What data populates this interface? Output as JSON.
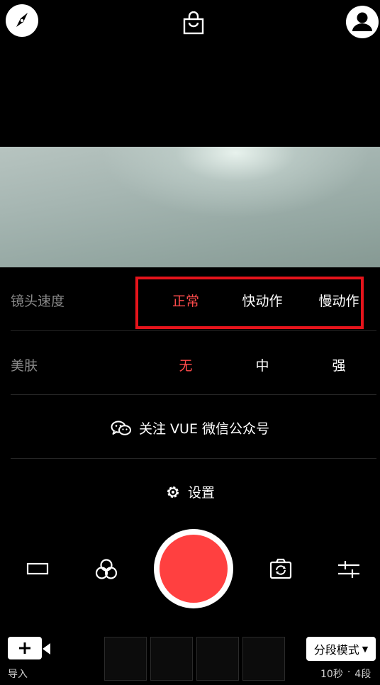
{
  "top_bar": {
    "compass_icon": "compass-icon",
    "bag_icon": "shopping-bag-icon",
    "profile_icon": "user-profile-icon"
  },
  "speed": {
    "label": "镜头速度",
    "options": [
      "正常",
      "快动作",
      "慢动作"
    ],
    "selected": "正常"
  },
  "beauty": {
    "label": "美肤",
    "options": [
      "无",
      "中",
      "强"
    ],
    "selected": "无"
  },
  "follow": {
    "text": "关注 VUE 微信公众号",
    "icon": "wechat-icon"
  },
  "settings": {
    "text": "设置",
    "icon": "gear-icon"
  },
  "bottom": {
    "import_label": "导入",
    "mode_label": "分段模式",
    "duration": "10秒",
    "separator": "·",
    "segments": "4段"
  },
  "colors": {
    "accent": "#ff4040",
    "active_text": "#ff4b4b",
    "highlight_border": "#e5141b",
    "background": "#000000"
  }
}
